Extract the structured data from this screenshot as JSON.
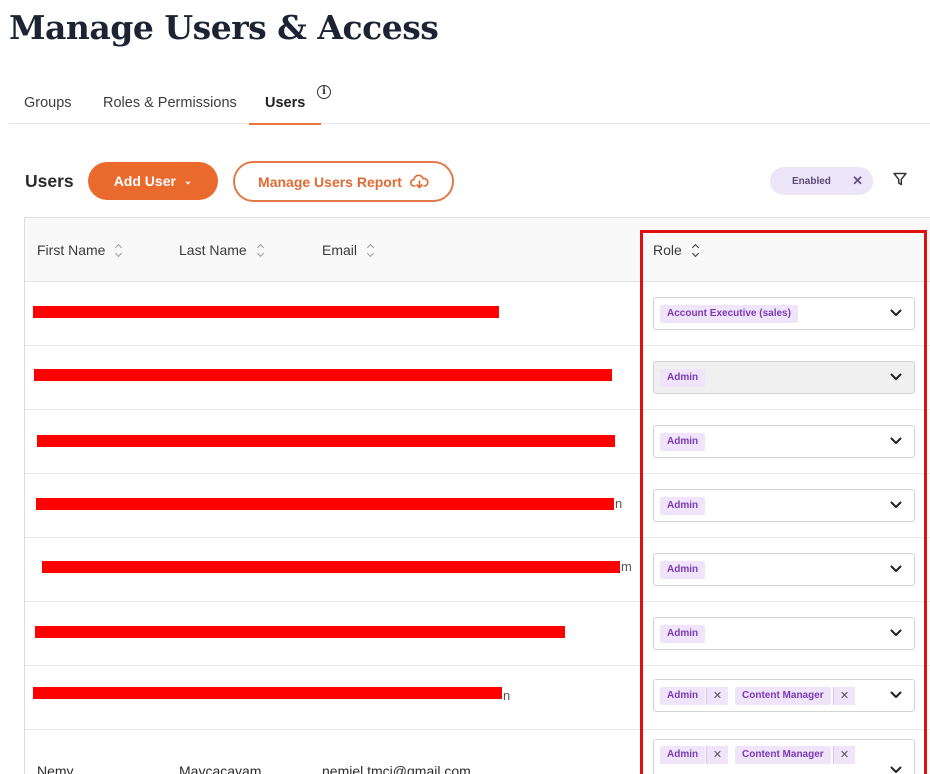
{
  "page": {
    "title": "Manage Users & Access"
  },
  "tabs": [
    {
      "label": "Groups",
      "active": false
    },
    {
      "label": "Roles & Permissions",
      "active": false
    },
    {
      "label": "Users",
      "active": true
    }
  ],
  "info_icon_glyph": "i",
  "toolbar": {
    "heading": "Users",
    "add_user_label": "Add User",
    "add_user_caret": "⌄",
    "report_label": "Manage Users Report",
    "filter_chip": {
      "label": "Enabled",
      "remove": "✕"
    }
  },
  "table": {
    "columns": [
      {
        "label": "First Name"
      },
      {
        "label": "Last Name"
      },
      {
        "label": "Email"
      },
      {
        "label": "Role"
      }
    ],
    "rows": [
      {
        "redacted": true,
        "email_tail": "",
        "roles": [
          "Account Executive (sales)"
        ]
      },
      {
        "redacted": true,
        "email_tail": "",
        "roles": [
          "Admin"
        ]
      },
      {
        "redacted": true,
        "email_tail": "",
        "roles": [
          "Admin"
        ]
      },
      {
        "redacted": true,
        "email_tail": "n",
        "roles": [
          "Admin"
        ]
      },
      {
        "redacted": true,
        "email_tail": "m",
        "roles": [
          "Admin"
        ]
      },
      {
        "redacted": true,
        "email_tail": "",
        "roles": [
          "Admin"
        ]
      },
      {
        "redacted": true,
        "email_tail": "n",
        "roles": [
          "Admin",
          "Content Manager"
        ]
      },
      {
        "redacted": false,
        "first_name": "Nemy",
        "last_name": "Maycacayam",
        "email": "nemiel.tmci@gmail.com",
        "roles": [
          "Admin",
          "Content Manager"
        ]
      }
    ],
    "tag_remove_glyph": "✕"
  },
  "colors": {
    "accent": "#ea6a2e",
    "tag_bg": "#efe4fa",
    "tag_text": "#7a3ab8",
    "redaction": "#ff0000",
    "highlight": "#e01010"
  }
}
